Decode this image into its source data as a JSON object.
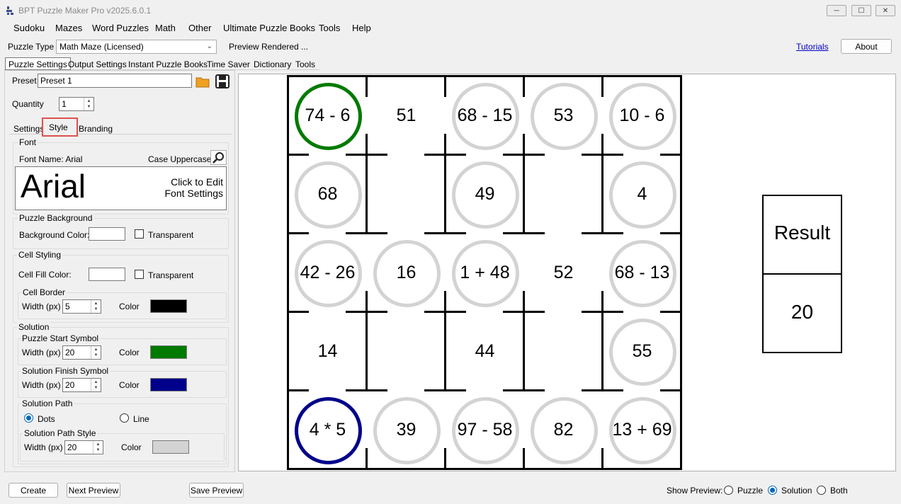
{
  "window": {
    "title": "BPT Puzzle Maker Pro v2025.6.0.1",
    "minimize": "─",
    "maximize": "☐",
    "close": "✕"
  },
  "menu": [
    "Sudoku",
    "Mazes",
    "Word Puzzles",
    "Math",
    "Other",
    "Ultimate Puzzle Books",
    "Tools",
    "Help"
  ],
  "toolbar": {
    "puzzle_type_label": "Puzzle Type",
    "puzzle_type_value": "Math Maze (Licensed)",
    "status": "Preview Rendered ...",
    "tutorials": "Tutorials",
    "about": "About"
  },
  "main_tabs": [
    "Puzzle Settings",
    "Output Settings",
    "Instant Puzzle Books",
    "Time Saver",
    "Dictionary",
    "Tools"
  ],
  "preset": {
    "label": "Preset",
    "value": "Preset 1"
  },
  "quantity": {
    "label": "Quantity",
    "value": "1"
  },
  "sub_tabs": [
    "Settings",
    "Style",
    "Branding"
  ],
  "font": {
    "group": "Font",
    "name_label": "Font Name: Arial",
    "case_label": "Case Uppercase",
    "sample": "Arial",
    "edit_line1": "Click to Edit",
    "edit_line2": "Font Settings"
  },
  "background": {
    "group": "Puzzle Background",
    "color_label": "Background Color:",
    "transparent": "Transparent"
  },
  "cell_styling": {
    "group": "Cell Styling",
    "fill_label": "Cell Fill Color:",
    "transparent": "Transparent"
  },
  "cell_border": {
    "group": "Cell Border",
    "width_label": "Width (px)",
    "width": "5",
    "color_label": "Color",
    "color": "#000000"
  },
  "solution": {
    "group": "Solution"
  },
  "start_symbol": {
    "group": "Puzzle Start Symbol",
    "width_label": "Width (px)",
    "width": "20",
    "color_label": "Color",
    "color": "#007a00"
  },
  "finish_symbol": {
    "group": "Solution Finish Symbol",
    "width_label": "Width (px)",
    "width": "20",
    "color_label": "Color",
    "color": "#00008b"
  },
  "solution_path": {
    "group": "Solution Path",
    "dots": "Dots",
    "line": "Line"
  },
  "path_style": {
    "group": "Solution Path Style",
    "width_label": "Width (px)",
    "width": "20",
    "color_label": "Color",
    "color": "#d3d3d3"
  },
  "puzzle": {
    "cells": [
      [
        "74 - 6",
        "51",
        "68 - 15",
        "53",
        "10 - 6"
      ],
      [
        "68",
        "",
        "49",
        "",
        "4"
      ],
      [
        "42 - 26",
        "16",
        "1 + 48",
        "52",
        "68 - 13"
      ],
      [
        "14",
        "",
        "44",
        "",
        "55"
      ],
      [
        "4 * 5",
        "39",
        "97 - 58",
        "82",
        "13 + 69"
      ]
    ],
    "result_label": "Result",
    "result_value": "20",
    "start_color": "#007a00",
    "finish_color": "#00008b",
    "path_color": "#d3d3d3"
  },
  "bottom": {
    "create": "Create",
    "next_preview": "Next Preview",
    "save_preview": "Save Preview",
    "show_preview": "Show Preview:",
    "puzzle": "Puzzle",
    "solution": "Solution",
    "both": "Both"
  }
}
